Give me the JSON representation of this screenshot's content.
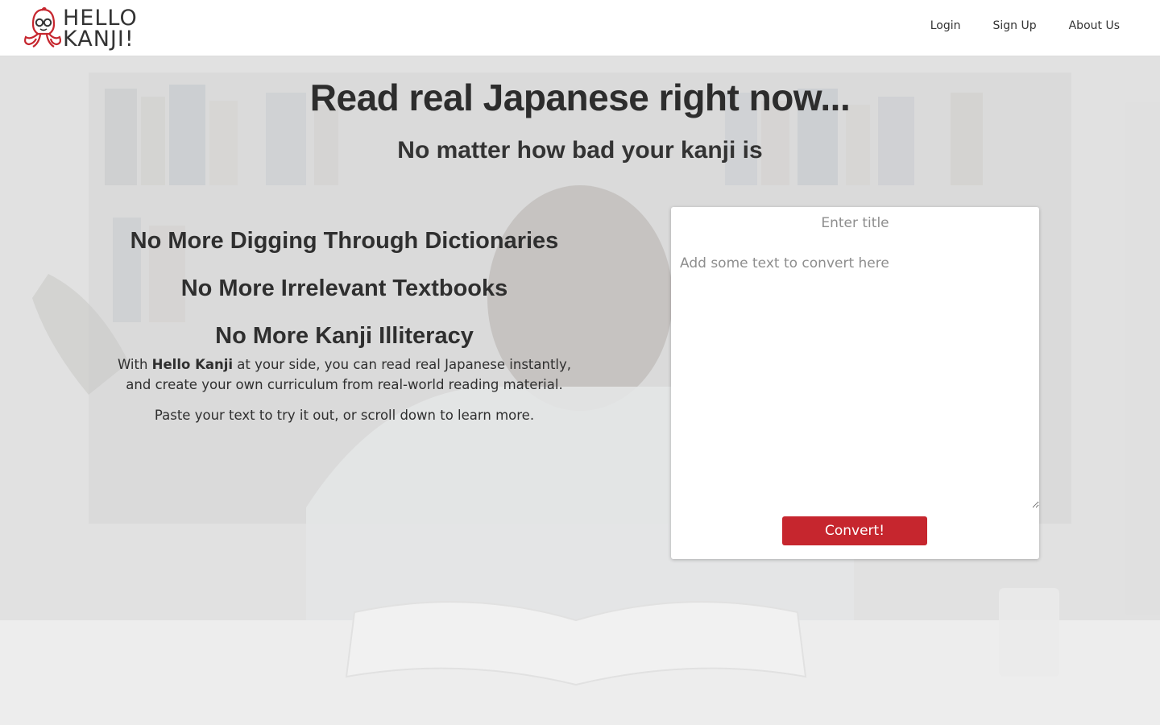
{
  "brand": {
    "logo_line1": "HELLO",
    "logo_line2": "KANJI!",
    "logo_icon": "octopus-mascot-icon",
    "accent_color": "#c6262e"
  },
  "nav": {
    "items": [
      {
        "label": "Login"
      },
      {
        "label": "Sign Up"
      },
      {
        "label": "About Us"
      }
    ]
  },
  "hero": {
    "headline": "Read real Japanese right now...",
    "subheadline": "No matter how bad your kanji is",
    "features": [
      {
        "label": "No More Digging Through Dictionaries"
      },
      {
        "label": "No More Irrelevant Textbooks"
      },
      {
        "label": "No More Kanji Illiteracy"
      }
    ],
    "description_prefix": "With ",
    "description_brand": "Hello Kanji",
    "description_suffix": " at your side, you can read real Japanese instantly, and create your own curriculum from real-world reading material.",
    "cta_text": "Paste your text to try it out, or scroll down to learn more."
  },
  "form": {
    "title_placeholder": "Enter title",
    "title_value": "",
    "text_placeholder": "Add some text to convert here",
    "text_value": "",
    "submit_label": "Convert!"
  }
}
